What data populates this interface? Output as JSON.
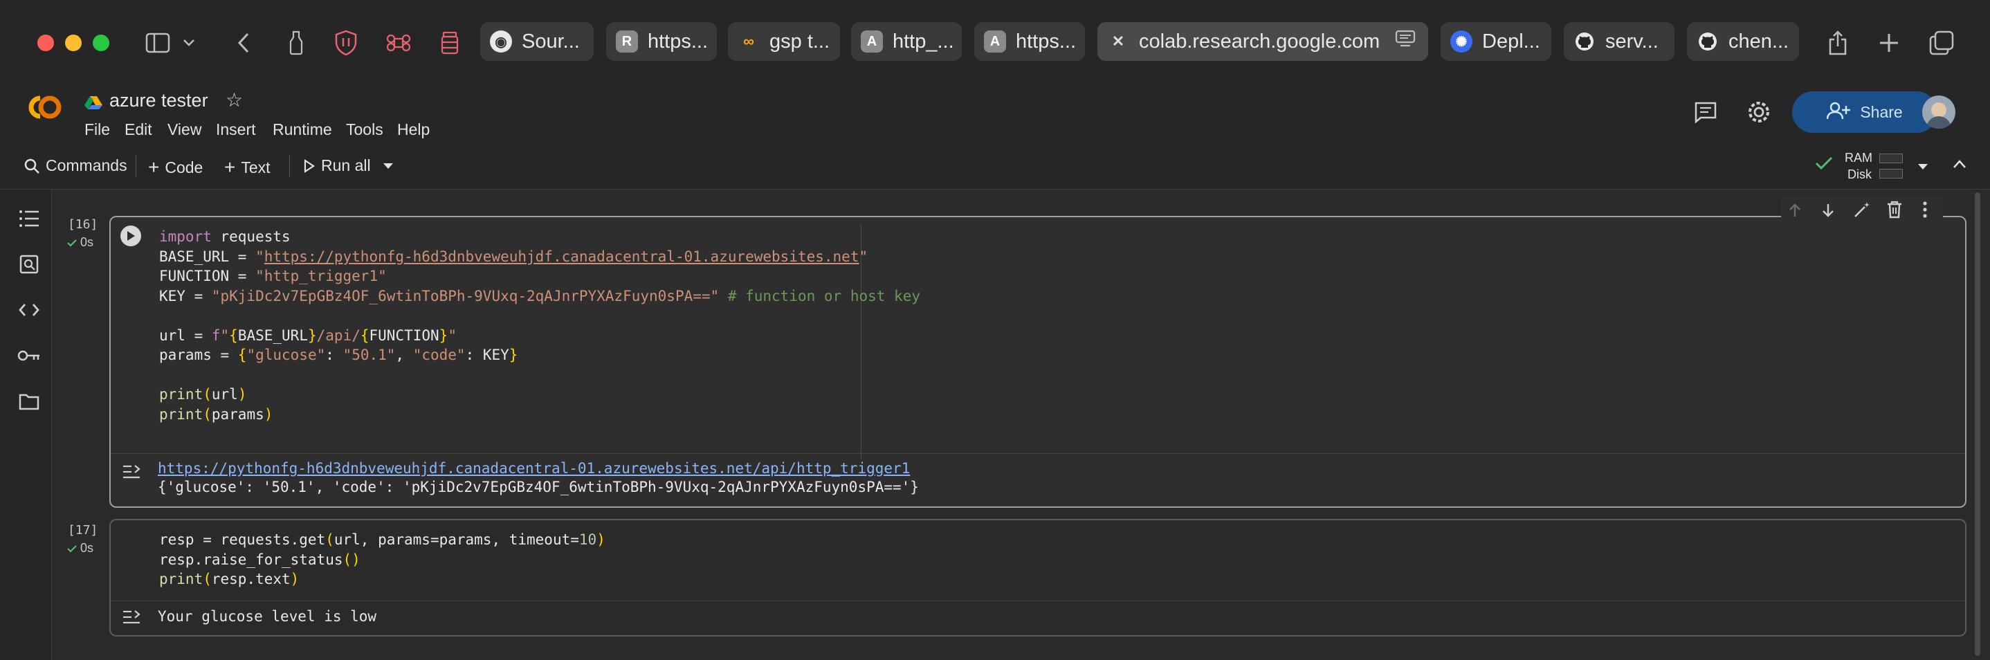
{
  "browser": {
    "tabs": [
      {
        "label": "Sour...",
        "icon": "source-icon"
      },
      {
        "label": "https...",
        "icon": "r-icon"
      },
      {
        "label": "gsp t...",
        "icon": "colab-icon"
      },
      {
        "label": "http_...",
        "icon": "a-icon"
      },
      {
        "label": "https...",
        "icon": "a-icon"
      },
      {
        "label": "colab.research.google.com",
        "icon": "close-icon",
        "active": true
      },
      {
        "label": "Depl...",
        "icon": "gear-flower-icon"
      },
      {
        "label": "serv...",
        "icon": "github-icon"
      },
      {
        "label": "chen...",
        "icon": "github-icon"
      }
    ],
    "colors": {
      "red": "#ff5f57",
      "yellow": "#febc2e",
      "green": "#28c840"
    }
  },
  "notebook": {
    "title": "azure tester",
    "menu": [
      "File",
      "Edit",
      "View",
      "Insert",
      "Runtime",
      "Tools",
      "Help"
    ],
    "share_label": "Share",
    "toolbar": {
      "commands": "Commands",
      "code": "Code",
      "text": "Text",
      "run_all": "Run all",
      "ram": "RAM",
      "disk": "Disk"
    }
  },
  "cells": [
    {
      "count": "[16]",
      "time": "0s",
      "code_lines": [
        "import requests",
        "BASE_URL = \"https://pythonfg-h6d3dnbveweuhjdf.canadacentral-01.azurewebsites.net\"",
        "FUNCTION = \"http_trigger1\"",
        "KEY = \"pKjiDc2v7EpGBz4OF_6wtinToBPh-9VUxq-2qAJnrPYXAzFuyn0sPA==\" # function or host key",
        "",
        "url = f\"{BASE_URL}/api/{FUNCTION}\"",
        "params = {\"glucose\": \"50.1\", \"code\": KEY}",
        "",
        "print(url)",
        "print(params)"
      ],
      "output_lines": [
        "https://pythonfg-h6d3dnbveweuhjdf.canadacentral-01.azurewebsites.net/api/http_trigger1",
        "{'glucose': '50.1', 'code': 'pKjiDc2v7EpGBz4OF_6wtinToBPh-9VUxq-2qAJnrPYXAzFuyn0sPA=='}"
      ]
    },
    {
      "count": "[17]",
      "time": "0s",
      "code_lines": [
        "resp = requests.get(url, params=params, timeout=10)",
        "resp.raise_for_status()",
        "print(resp.text)"
      ],
      "output_lines": [
        "Your glucose level is low"
      ]
    }
  ],
  "colors": {
    "accent": "#f9ab00",
    "share_bg": "#1a4f8a",
    "link": "#8ab4f8"
  }
}
